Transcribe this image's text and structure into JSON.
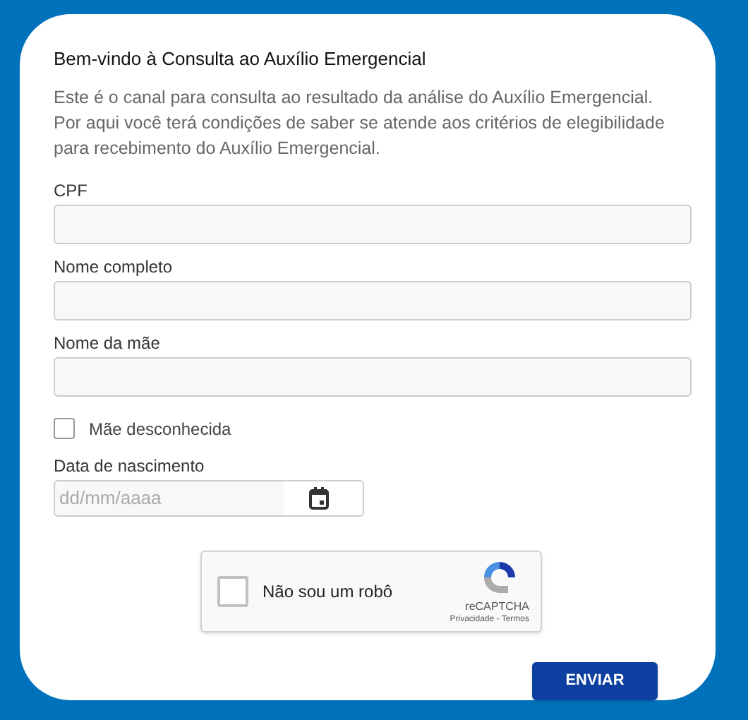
{
  "title": "Bem-vindo à Consulta ao Auxílio Emergencial",
  "intro": [
    "Este é o canal para consulta ao resultado da análise do Auxílio Emergencial.",
    "Por aqui você terá condições de saber se atende aos critérios de elegibilidade para recebimento do Auxílio Emergencial."
  ],
  "fields": [
    {
      "label": "CPF"
    },
    {
      "label": "Nome completo"
    },
    {
      "label": "Nome da mãe"
    }
  ],
  "unknown_mother": {
    "label": "Mãe desconhecida",
    "checked": false
  },
  "birth_date": {
    "label": "Data de nascimento",
    "placeholder": "dd/mm/aaaa"
  },
  "captcha": {
    "label": "Não sou um robô",
    "checked": false,
    "brand": "reCAPTCHA",
    "links": "Privacidade - Termos"
  },
  "submit": "ENVIAR"
}
